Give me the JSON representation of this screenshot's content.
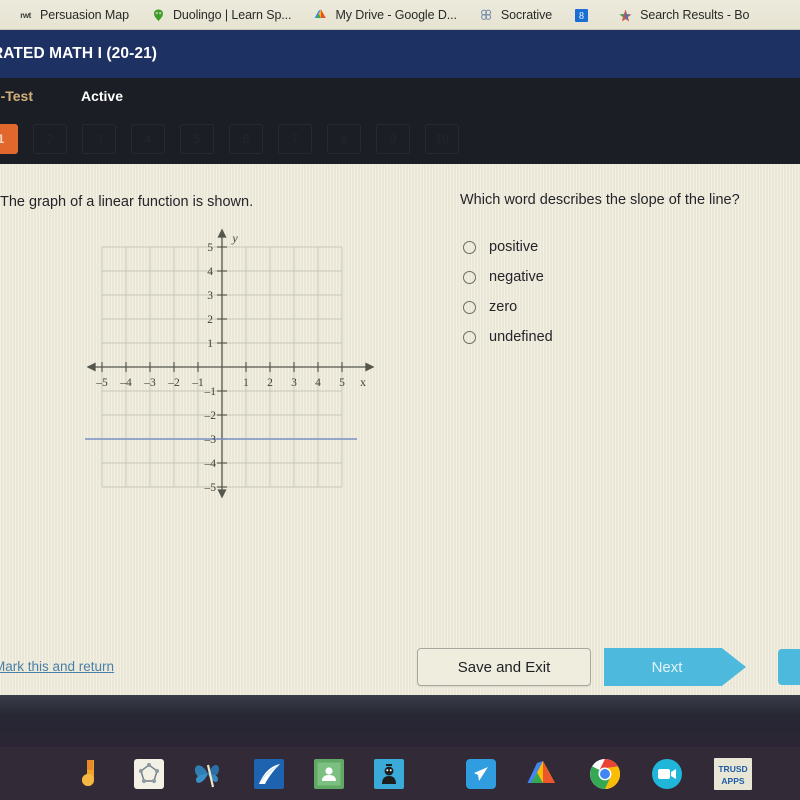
{
  "browser": {
    "bookmarks": [
      {
        "label": "Persuasion Map",
        "icon": "rwt-icon"
      },
      {
        "label": "Duolingo | Learn Sp...",
        "icon": "duolingo-owl-icon"
      },
      {
        "label": "My Drive - Google D...",
        "icon": "google-drive-icon"
      },
      {
        "label": "Socrative",
        "icon": "socrative-icon"
      },
      {
        "label": "",
        "icon": "blue-8-icon"
      },
      {
        "label": "Search Results - Bo",
        "icon": "colorful-star-icon"
      }
    ]
  },
  "course": {
    "title": "RATED MATH I (20-21)"
  },
  "tabs": [
    {
      "label": "Pre-Test",
      "state": "selected"
    },
    {
      "label": "Active",
      "state": "normal"
    }
  ],
  "question_nav": {
    "items": [
      {
        "number": "1",
        "state": "current"
      },
      {
        "number": "2",
        "state": "dim"
      },
      {
        "number": "3",
        "state": "dim"
      },
      {
        "number": "4",
        "state": "dim"
      },
      {
        "number": "5",
        "state": "dim"
      },
      {
        "number": "6",
        "state": "dim"
      },
      {
        "number": "7",
        "state": "dim"
      },
      {
        "number": "8",
        "state": "dim"
      },
      {
        "number": "9",
        "state": "dim"
      },
      {
        "number": "10",
        "state": "dim"
      }
    ]
  },
  "question": {
    "stem_left": "The graph of a linear function is shown.",
    "stem_right": "Which word describes the slope of the line?",
    "choices": [
      {
        "label": "positive",
        "selected": false
      },
      {
        "label": "negative",
        "selected": false
      },
      {
        "label": "zero",
        "selected": false
      },
      {
        "label": "undefined",
        "selected": false
      }
    ]
  },
  "chart_data": {
    "type": "line",
    "title": "",
    "xlabel": "x",
    "ylabel": "y",
    "xlim": [
      -5.8,
      5.8
    ],
    "ylim": [
      -5.8,
      5.8
    ],
    "xticks": [
      -5,
      -4,
      -3,
      -2,
      -1,
      1,
      2,
      3,
      4,
      5
    ],
    "yticks": [
      5,
      4,
      3,
      2,
      1,
      -1,
      -2,
      -3,
      -4,
      -5
    ],
    "xtick_labels": [
      "–5",
      "–4",
      "–3",
      "–2",
      "–1",
      "1",
      "2",
      "3",
      "4",
      "5"
    ],
    "ytick_labels": [
      "5",
      "4",
      "3",
      "2",
      "1",
      "–1",
      "–2",
      "–3",
      "–4",
      "–5"
    ],
    "grid": true,
    "grid_color": "#b9b7a4",
    "axis_color": "#55564c",
    "series": [
      {
        "name": "linear function",
        "equation": "y = -3",
        "color": "#7b8fc4",
        "x": [
          -6.2,
          6.2
        ],
        "values": [
          -3,
          -3
        ]
      }
    ]
  },
  "footer": {
    "mark_return_label": "Mark this and return",
    "save_exit_label": "Save and Exit",
    "next_label": "Next"
  },
  "taskbar": {
    "icons": [
      {
        "name": "desmos-icon",
        "color": "#f0a828"
      },
      {
        "name": "geogebra-icon",
        "color": "#f2efe6"
      },
      {
        "name": "butterfly-icon",
        "color": "#2f7fb5"
      },
      {
        "name": "clever-icon",
        "color": "#1d5fa8"
      },
      {
        "name": "google-classroom-icon",
        "color": "#63a66b"
      },
      {
        "name": "kahoot-icon",
        "color": "#3aabd9"
      },
      {
        "name": "nearpod-icon",
        "color": "#2f9de0"
      },
      {
        "name": "google-drive-icon",
        "color": "#34a853"
      },
      {
        "name": "chrome-icon",
        "color": "#4285f4"
      },
      {
        "name": "zoom-icon",
        "color": "#1fb6d9"
      },
      {
        "name": "trusd-apps-icon",
        "color": "#dcdccb",
        "label": "TRUSD APPS"
      }
    ]
  },
  "colors": {
    "page_bg": "#edead9",
    "header_navy": "#1d3163",
    "tabstrip_dark": "#1b1e25",
    "accent_orange": "#e2672c",
    "accent_cyan": "#4cb9dd",
    "link_blue": "#4a7fa5",
    "line_blue": "#7b8fc4"
  }
}
